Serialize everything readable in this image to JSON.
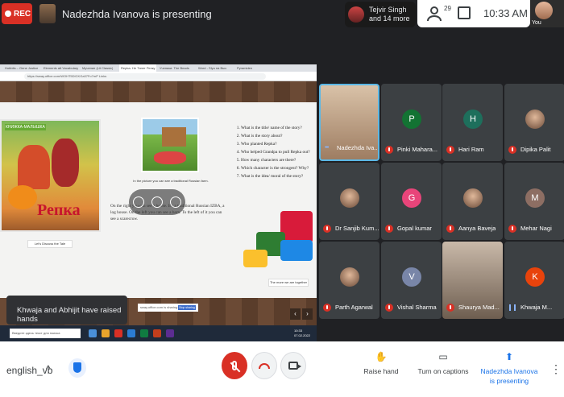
{
  "top": {
    "rec_label": "REC",
    "presenting_title": "Nadezhda Ivanova is presenting",
    "people_chip": {
      "line1": "Tejvir Singh",
      "line2": "and 14 more"
    },
    "participant_count": "29",
    "time": "10:33 AM",
    "self_label": "You"
  },
  "shared_screen": {
    "tabs": [
      "Hobbits – Gene Justice",
      "Elements att Vocabulary",
      "Мучение (Lit Classic)",
      "Repka- Не Тянет Репку",
      "Ученики: The Beads",
      "Word - Slyu на Выз",
      "Pyramiden"
    ],
    "url": "https://sway.office.com/WOHT5DICKGa37Fo7mP Links",
    "book_header": "КНИЖКА-МАЛЫШКА",
    "book_title": "Репка",
    "book_caption": "Let's Discuss the Tale",
    "scene_caption": "In the picture you can see a traditional Russian farm.",
    "body_text": "On the right you can see a house. It's a traditional Russian IZBA, a log house. On the left you can see a barn. To the left of it you can see a scarecrow.",
    "questions": [
      "What is the title/ name of the story?",
      "What is the story about?",
      "Who planted Repka?",
      "Who helped Grandpa to pull Repka out?",
      "How many characters are there?",
      "Which character is the strongest? Why?",
      "What is the idea/ moral of the story?"
    ],
    "puzzle_caption": "The more we are together",
    "sharing_strip": "sway.office.com is sharing your screen.",
    "stop_sharing_label": "Stop sharing",
    "taskbar_search": "Введите здесь текст для поиска",
    "taskbar_time": "10:33",
    "taskbar_date": "07.02.2022",
    "nav_prev": "‹",
    "nav_next": "›"
  },
  "toast": "Khwaja and Abhijit have raised hands",
  "participants": [
    {
      "name": "Nadezhda Iva...",
      "initial": "",
      "color": "",
      "kind": "photo",
      "status": "speaking"
    },
    {
      "name": "Pinki Mahara...",
      "initial": "P",
      "color": "#137333",
      "kind": "initial",
      "status": "muted"
    },
    {
      "name": "Hari Ram",
      "initial": "H",
      "color": "#1e6f5c",
      "kind": "initial",
      "status": "muted"
    },
    {
      "name": "Dipika Palit",
      "initial": "",
      "color": "",
      "kind": "avatar",
      "status": "muted"
    },
    {
      "name": "Dr Sanjib Kum...",
      "initial": "",
      "color": "",
      "kind": "avatar",
      "status": "muted"
    },
    {
      "name": "Gopal kumar",
      "initial": "G",
      "color": "#e8457a",
      "kind": "initial",
      "status": "muted"
    },
    {
      "name": "Aanya Baveja",
      "initial": "",
      "color": "",
      "kind": "avatar",
      "status": "muted"
    },
    {
      "name": "Mehar Nagi",
      "initial": "M",
      "color": "#8d6e63",
      "kind": "initial",
      "status": "muted"
    },
    {
      "name": "Parth Agarwal",
      "initial": "",
      "color": "",
      "kind": "avatar",
      "status": "muted"
    },
    {
      "name": "Vishal Sharma",
      "initial": "V",
      "color": "#7986a8",
      "kind": "initial",
      "status": "muted"
    },
    {
      "name": "Shaurya Mad...",
      "initial": "",
      "color": "",
      "kind": "photo",
      "status": "muted"
    },
    {
      "name": "Khwaja M...",
      "initial": "K",
      "color": "#e8430c",
      "kind": "initial",
      "status": "talking"
    }
  ],
  "bottom": {
    "meeting_code": "english_vb",
    "chevron": "^",
    "actions": [
      {
        "label": "Raise hand",
        "icon": "hand-icon"
      },
      {
        "label": "Turn on captions",
        "icon": "captions-icon"
      },
      {
        "label": "Nadezhda Ivanova is presenting",
        "icon": "present-icon"
      }
    ],
    "more": "⋮"
  }
}
